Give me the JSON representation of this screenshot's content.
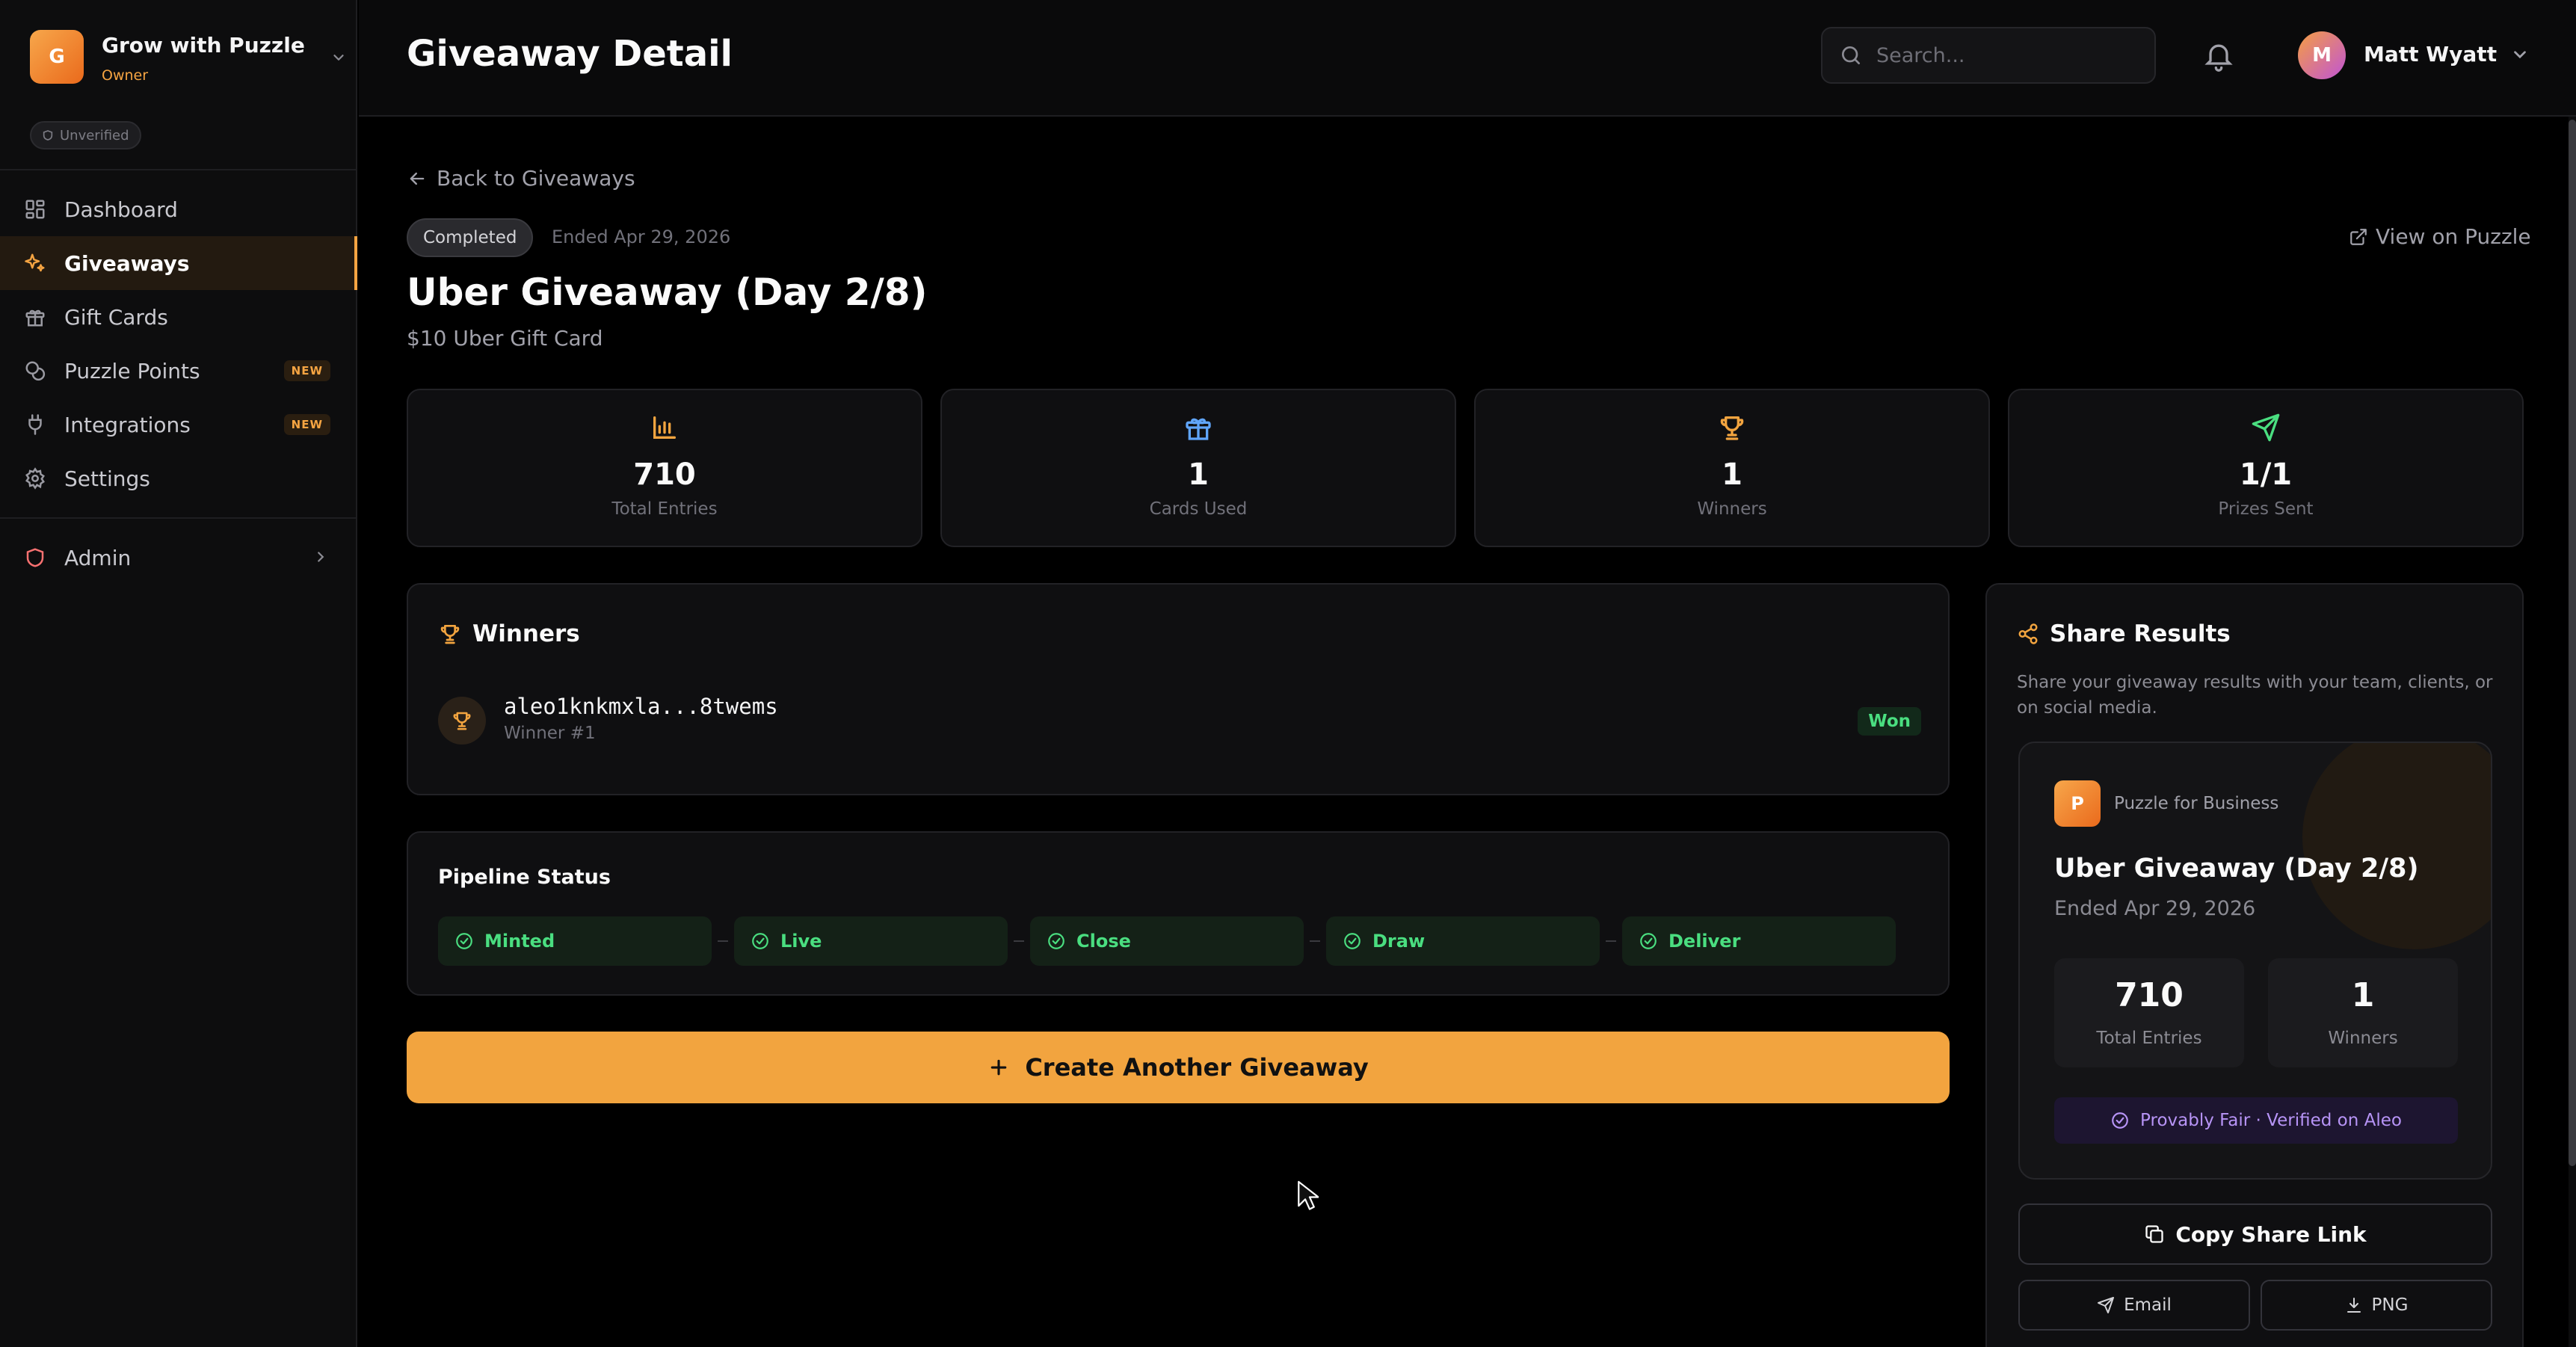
{
  "colors": {
    "accent": "#f2a43f",
    "success": "#4ade80",
    "purple": "#b794f6",
    "background": "#000000"
  },
  "org": {
    "initial": "G",
    "name": "Grow with Puzzle",
    "role": "Owner",
    "verification": "Unverified"
  },
  "sidebar": {
    "items": [
      {
        "label": "Dashboard",
        "icon": "dashboard-grid-icon"
      },
      {
        "label": "Giveaways",
        "icon": "sparkles-icon",
        "active": true
      },
      {
        "label": "Gift Cards",
        "icon": "gift-icon"
      },
      {
        "label": "Puzzle Points",
        "icon": "coins-icon",
        "badge": "NEW"
      },
      {
        "label": "Integrations",
        "icon": "plug-icon",
        "badge": "NEW"
      },
      {
        "label": "Settings",
        "icon": "gear-icon"
      }
    ],
    "admin": {
      "label": "Admin",
      "icon": "shield-icon"
    }
  },
  "header": {
    "title": "Giveaway Detail",
    "search_placeholder": "Search...",
    "user": {
      "initial": "M",
      "name": "Matt Wyatt"
    }
  },
  "giveaway": {
    "back_label": "Back to Giveaways",
    "status": "Completed",
    "ended": "Ended Apr 29, 2026",
    "view_link": "View on Puzzle",
    "title": "Uber Giveaway (Day 2/8)",
    "subtitle": "$10 Uber Gift Card"
  },
  "stats": [
    {
      "value": "710",
      "label": "Total Entries",
      "icon": "bar-chart-icon",
      "color": "#f2a43f"
    },
    {
      "value": "1",
      "label": "Cards Used",
      "icon": "gift-icon",
      "color": "#60a5fa"
    },
    {
      "value": "1",
      "label": "Winners",
      "icon": "trophy-icon",
      "color": "#f2a43f"
    },
    {
      "value": "1/1",
      "label": "Prizes Sent",
      "icon": "send-icon",
      "color": "#4ade80"
    }
  ],
  "winners": {
    "title": "Winners",
    "list": [
      {
        "address": "aleo1knkmxla...8twems",
        "rank": "Winner #1",
        "status": "Won"
      }
    ]
  },
  "pipeline": {
    "title": "Pipeline Status",
    "stages": [
      "Minted",
      "Live",
      "Close",
      "Draw",
      "Deliver"
    ]
  },
  "create_button": "Create Another Giveaway",
  "share": {
    "title": "Share Results",
    "description": "Share your giveaway results with your team, clients, or on social media.",
    "card": {
      "logo": "P",
      "brand": "Puzzle for Business",
      "title": "Uber Giveaway (Day 2/8)",
      "ended": "Ended Apr 29, 2026",
      "stats": [
        {
          "value": "710",
          "label": "Total Entries"
        },
        {
          "value": "1",
          "label": "Winners"
        }
      ],
      "fair_badge": "Provably Fair · Verified on Aleo"
    },
    "copy_label": "Copy Share Link",
    "email_label": "Email",
    "png_label": "PNG"
  }
}
